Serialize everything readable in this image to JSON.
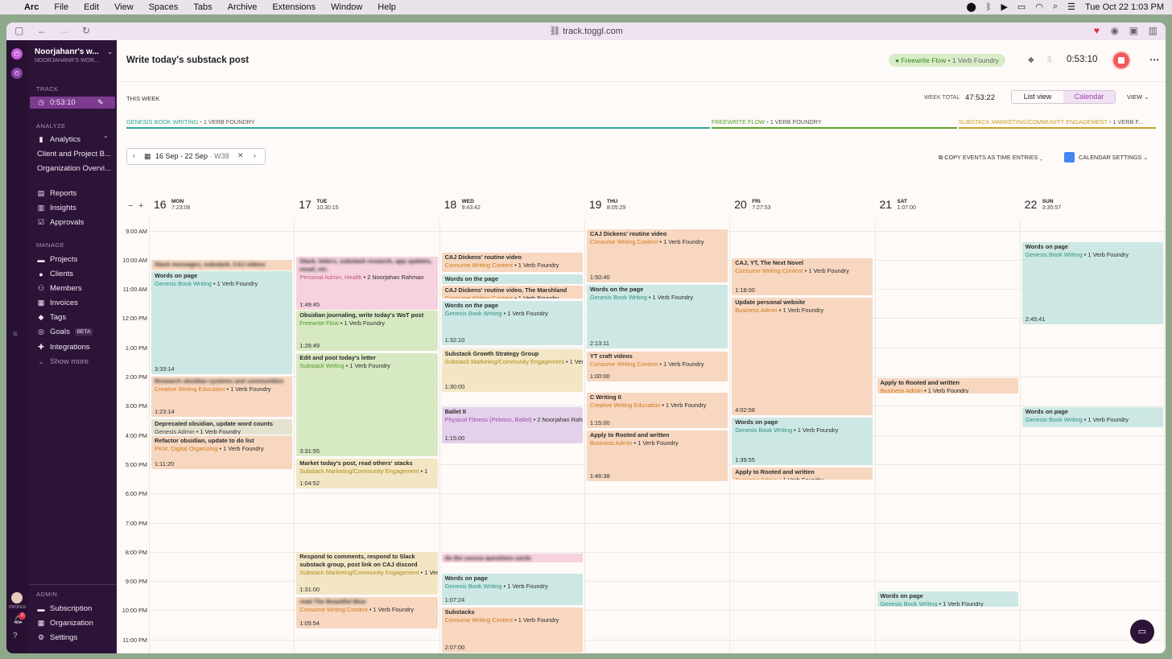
{
  "menubar": {
    "app": "Arc",
    "items": [
      "File",
      "Edit",
      "View",
      "Spaces",
      "Tabs",
      "Archive",
      "Extensions",
      "Window",
      "Help"
    ],
    "clock": "Tue Oct 22  1:03 PM"
  },
  "browser": {
    "url": "track.toggl.com"
  },
  "sidebar": {
    "workspace": "Noorjahanr's w...",
    "workspace_sub": "NOORJAHANR'S WOR...",
    "track_label": "TRACK",
    "timer": "0:53:10",
    "analyze_label": "ANALYZE",
    "analytics": "Analytics",
    "analytics_sub": [
      "Client and Project B...",
      "Organization Overvi..."
    ],
    "reports": "Reports",
    "insights": "Insights",
    "approvals": "Approvals",
    "manage_label": "MANAGE",
    "manage_items": [
      "Projects",
      "Clients",
      "Members",
      "Invoices",
      "Tags",
      "Goals",
      "Integrations",
      "Show more"
    ],
    "goals_badge": "BETA",
    "admin_label": "ADMIN",
    "admin_items": [
      "Subscription",
      "Organization",
      "Settings"
    ],
    "profile_label": "PROFILE",
    "notif_count": "2"
  },
  "header": {
    "title": "Write today's substack post",
    "project_pill": "Freewrite Flow",
    "pill_client": "1 Verb Foundry",
    "timer": "0:53:10"
  },
  "week": {
    "this_week": "THIS WEEK",
    "total_label": "WEEK TOTAL",
    "total": "47:53:22",
    "list_view": "List view",
    "calendar": "Calendar",
    "view": "VIEW",
    "projects": [
      {
        "name": "GENESIS BOOK WRITING",
        "client": "1 VERB FOUNDRY",
        "color": "#2fa69a"
      },
      {
        "name": "FREEWRITE FLOW",
        "client": "1 VERB FOUNDRY",
        "color": "#58a12a"
      },
      {
        "name": "SUBSTACK MARKETING/COMMUNITY ENGAGEMENT",
        "client": "1 VERB F...",
        "color": "#c9a227"
      }
    ],
    "range": "16 Sep - 22 Sep",
    "range_week": "· W38",
    "copy": "COPY EVENTS AS TIME ENTRIES",
    "cal_settings": "CALENDAR SETTINGS"
  },
  "days": [
    {
      "num": "16",
      "name": "MON",
      "total": "7:23:06"
    },
    {
      "num": "17",
      "name": "TUE",
      "total": "10:30:15"
    },
    {
      "num": "18",
      "name": "WED",
      "total": "9:43:42"
    },
    {
      "num": "19",
      "name": "THU",
      "total": "8:05:29"
    },
    {
      "num": "20",
      "name": "FRI",
      "total": "7:27:53"
    },
    {
      "num": "21",
      "name": "SAT",
      "total": "1:07:00"
    },
    {
      "num": "22",
      "name": "SUN",
      "total": "3:35:57"
    }
  ],
  "hours": [
    "9:00 AM",
    "10:00 AM",
    "11:00 AM",
    "12:00 PM",
    "1:00 PM",
    "2:00 PM",
    "3:00 PM",
    "4:00 PM",
    "5:00 PM",
    "6:00 PM",
    "7:00 PM",
    "8:00 PM",
    "9:00 PM",
    "10:00 PM",
    "11:00 PM"
  ],
  "events": [
    {
      "day": 0,
      "start": 10.0,
      "end": 10.4,
      "c": "orange",
      "t": "Slack messages, substack, CAJ videos",
      "p": "Consume Writing Content",
      "cl": "1 Verb Foundry",
      "d": "",
      "blur": true
    },
    {
      "day": 0,
      "start": 10.4,
      "end": 13.95,
      "c": "teal",
      "t": "Words on page",
      "p": "Genesis Book Writing",
      "cl": "1 Verb Foundry",
      "d": "3:33:14"
    },
    {
      "day": 0,
      "start": 14.0,
      "end": 15.4,
      "c": "orange",
      "t": "Research obsidian systems and communities",
      "p": "Creative Writing Education",
      "cl": "1 Verb Foundry",
      "d": "1:23:14",
      "blur": true
    },
    {
      "day": 0,
      "start": 15.45,
      "end": 16.0,
      "c": "gray",
      "t": "Deprecated obsidian, update word counts",
      "p": "Genesis Admin",
      "cl": "1 Verb Foundry",
      "d": ""
    },
    {
      "day": 0,
      "start": 16.05,
      "end": 17.2,
      "c": "orange",
      "t": "Refactor obsidian, update to do list",
      "p": "PKM, Digital Organizing",
      "cl": "1 Verb Foundry",
      "d": "1:11:20"
    },
    {
      "day": 1,
      "start": 9.9,
      "end": 11.75,
      "c": "pink",
      "t": "Slack, letters, substack research, app updates, email, etc.",
      "p": "Personal Admin, Health",
      "cl": "2 Noorjahan Rahman",
      "d": "1:49:45",
      "blur": true
    },
    {
      "day": 1,
      "start": 11.75,
      "end": 13.15,
      "c": "green",
      "t": "Obsidian journaling, write today's WoT post",
      "p": "Freewrite Flow",
      "cl": "1 Verb Foundry",
      "d": "1:26:49"
    },
    {
      "day": 1,
      "start": 13.2,
      "end": 16.75,
      "c": "green",
      "t": "Edit and post today's letter",
      "p": "Substack Writing",
      "cl": "1 Verb Foundry",
      "d": "3:31:55"
    },
    {
      "day": 1,
      "start": 16.8,
      "end": 17.85,
      "c": "yellow",
      "t": "Market today's post, read others' stacks",
      "p": "Substack Marketing/Community Engagement",
      "cl": "1",
      "d": "1:04:52"
    },
    {
      "day": 1,
      "start": 20.0,
      "end": 21.5,
      "c": "yellow",
      "t": "Respond to comments, respond to Slack substack group, post link on CAJ discord",
      "p": "Substack Marketing/Community Engagement",
      "cl": "1 Verb Foundry",
      "d": "1:31:00"
    },
    {
      "day": 1,
      "start": 21.55,
      "end": 22.65,
      "c": "orange",
      "t": "read The Beautiful Blue",
      "p": "Consume Writing Content",
      "cl": "1 Verb Foundry",
      "d": "1:05:54",
      "blur": true
    },
    {
      "day": 2,
      "start": 9.75,
      "end": 10.45,
      "c": "orange",
      "t": "CAJ Dickens' routine video",
      "p": "Consume Writing Content",
      "cl": "1 Verb Foundry",
      "d": ""
    },
    {
      "day": 2,
      "start": 10.5,
      "end": 10.85,
      "c": "teal",
      "t": "Words on the page",
      "p": "",
      "cl": "",
      "d": ""
    },
    {
      "day": 2,
      "start": 10.9,
      "end": 11.35,
      "c": "orange",
      "t": "CAJ Dickens' routine video, The Marshland",
      "p": "Consume Writing Content",
      "cl": "1 Verb Foundry",
      "d": ""
    },
    {
      "day": 2,
      "start": 11.4,
      "end": 12.95,
      "c": "teal",
      "t": "Words on the page",
      "p": "Genesis Book Writing",
      "cl": "1 Verb Foundry",
      "d": "1:32:10"
    },
    {
      "day": 2,
      "start": 13.05,
      "end": 14.55,
      "c": "yellow",
      "t": "Substack Growth Strategy Group",
      "p": "Substack Marketing/Community Engagement",
      "cl": "1 Verb Foundry",
      "d": "1:30:00"
    },
    {
      "day": 2,
      "start": 15.05,
      "end": 16.3,
      "c": "purple",
      "t": "Ballet II",
      "p": "Physical Fitness (Peloton, Ballet)",
      "cl": "2 Noorjahan Rahman",
      "d": "1:15:00"
    },
    {
      "day": 2,
      "start": 20.05,
      "end": 20.4,
      "c": "pink",
      "t": "do the course questions cards",
      "p": "",
      "cl": "",
      "d": "",
      "blur": true
    },
    {
      "day": 2,
      "start": 20.75,
      "end": 21.85,
      "c": "teal",
      "t": "Words on page",
      "p": "Genesis Book Writing",
      "cl": "1 Verb Foundry",
      "d": "1:07:24"
    },
    {
      "day": 2,
      "start": 21.9,
      "end": 23.95,
      "c": "orange",
      "t": "Substacks",
      "p": "Consume Writing Content",
      "cl": "1 Verb Foundry",
      "d": "2:07:00"
    },
    {
      "day": 3,
      "start": 8.95,
      "end": 10.8,
      "c": "orange",
      "t": "CAJ Dickens' routine video",
      "p": "Consume Writing Content",
      "cl": "1 Verb Foundry",
      "d": "1:50:40"
    },
    {
      "day": 3,
      "start": 10.85,
      "end": 13.05,
      "c": "teal",
      "t": "Words on the page",
      "p": "Genesis Book Writing",
      "cl": "1 Verb Foundry",
      "d": "2:13:11"
    },
    {
      "day": 3,
      "start": 13.15,
      "end": 14.2,
      "c": "orange",
      "t": "YT craft videos",
      "p": "Consume Writing Content",
      "cl": "1 Verb Foundry",
      "d": "1:00:00"
    },
    {
      "day": 3,
      "start": 14.55,
      "end": 15.8,
      "c": "orange",
      "t": "C Writing II",
      "p": "Creative Writing Education",
      "cl": "1 Verb Foundry",
      "d": "1:15:00"
    },
    {
      "day": 3,
      "start": 15.85,
      "end": 17.6,
      "c": "orange",
      "t": "Apply to Rooted and written",
      "p": "Business Admin",
      "cl": "1 Verb Foundry",
      "d": "1:46:38"
    },
    {
      "day": 4,
      "start": 9.95,
      "end": 11.25,
      "c": "orange",
      "t": "CAJ, YT, The Next Novel",
      "p": "Consume Writing Content",
      "cl": "1 Verb Foundry",
      "d": "1:18:00"
    },
    {
      "day": 4,
      "start": 11.3,
      "end": 15.35,
      "c": "orange",
      "t": "Update personal website",
      "p": "Business Admin",
      "cl": "1 Verb Foundry",
      "d": "4:02:58"
    },
    {
      "day": 4,
      "start": 15.4,
      "end": 17.05,
      "c": "teal",
      "t": "Words on page",
      "p": "Genesis Book Writing",
      "cl": "1 Verb Foundry",
      "d": "1:39:55"
    },
    {
      "day": 4,
      "start": 17.1,
      "end": 17.55,
      "c": "orange",
      "t": "Apply to Rooted and written",
      "p": "Business Admin",
      "cl": "1 Verb Foundry",
      "d": ""
    },
    {
      "day": 5,
      "start": 14.05,
      "end": 14.6,
      "c": "orange",
      "t": "Apply to Rooted and written",
      "p": "Business Admin",
      "cl": "1 Verb Foundry",
      "d": ""
    },
    {
      "day": 5,
      "start": 21.35,
      "end": 21.9,
      "c": "teal",
      "t": "Words on page",
      "p": "Genesis Book Writing",
      "cl": "1 Verb Foundry",
      "d": ""
    },
    {
      "day": 6,
      "start": 9.4,
      "end": 12.25,
      "c": "teal",
      "t": "Words on page",
      "p": "Genesis Book Writing",
      "cl": "1 Verb Foundry",
      "d": "2:45:41"
    },
    {
      "day": 6,
      "start": 15.05,
      "end": 15.75,
      "c": "teal",
      "t": "Words on page",
      "p": "Genesis Book Writing",
      "cl": "1 Verb Foundry",
      "d": ""
    }
  ],
  "colors": {
    "orange_text": "#d07a1c",
    "teal_text": "#2a9384",
    "green_text": "#4e9b21",
    "yellow_text": "#b08a13",
    "purple_text": "#9b4fb3",
    "pink_text": "#c4577a",
    "gray_text": "#4a4a4a",
    "accent": "#9b3fb0"
  }
}
